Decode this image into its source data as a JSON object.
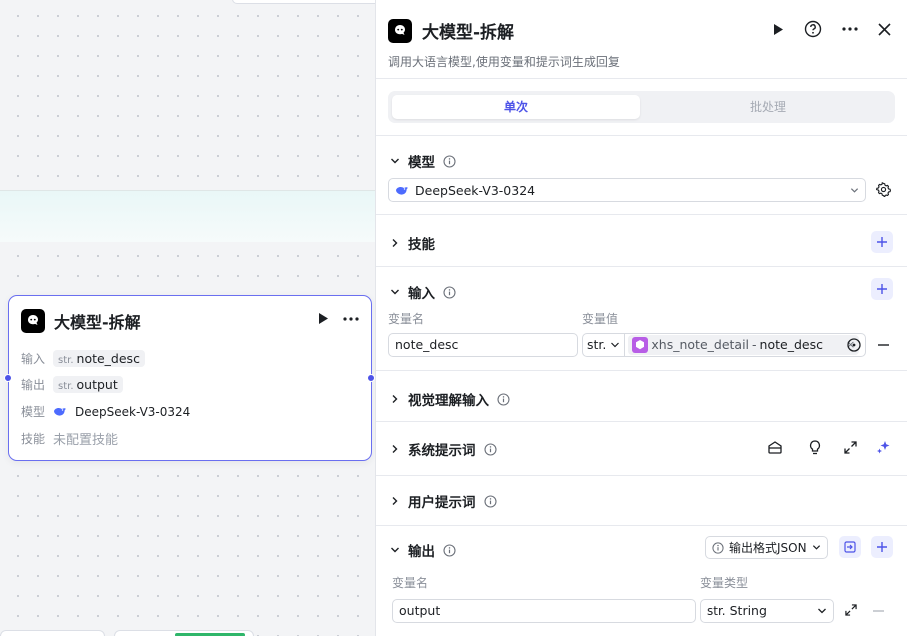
{
  "node": {
    "title": "大模型-拆解",
    "rows": [
      {
        "label": "输入",
        "type": "str.",
        "value": "note_desc"
      },
      {
        "label": "输出",
        "type": "str.",
        "value": "output"
      },
      {
        "label": "模型",
        "value": "DeepSeek-V3-0324"
      },
      {
        "label": "技能",
        "value": "未配置技能"
      }
    ]
  },
  "panel": {
    "title": "大模型-拆解",
    "description": "调用大语言模型,使用变量和提示词生成回复",
    "tabs": {
      "single": "单次",
      "batch": "批处理"
    },
    "sections": {
      "model": "模型",
      "skills": "技能",
      "input": "输入",
      "vision": "视觉理解输入",
      "system_prompt": "系统提示词",
      "user_prompt": "用户提示词",
      "output": "输出"
    },
    "model_value": "DeepSeek-V3-0324",
    "input_labels": {
      "name": "变量名",
      "value": "变量值"
    },
    "input_row": {
      "name": "note_desc",
      "type": "str.",
      "ref_node": "xhs_note_detail",
      "ref_sep": "-",
      "ref_field": "note_desc"
    },
    "output_format": "输出格式JSON",
    "output_labels": {
      "name": "变量名",
      "type": "变量类型"
    },
    "output_row": {
      "name": "output",
      "type_prefix": "str.",
      "type": "String"
    }
  },
  "colors": {
    "accent": "#4d53e8",
    "canvas": "#f3f4f6"
  }
}
